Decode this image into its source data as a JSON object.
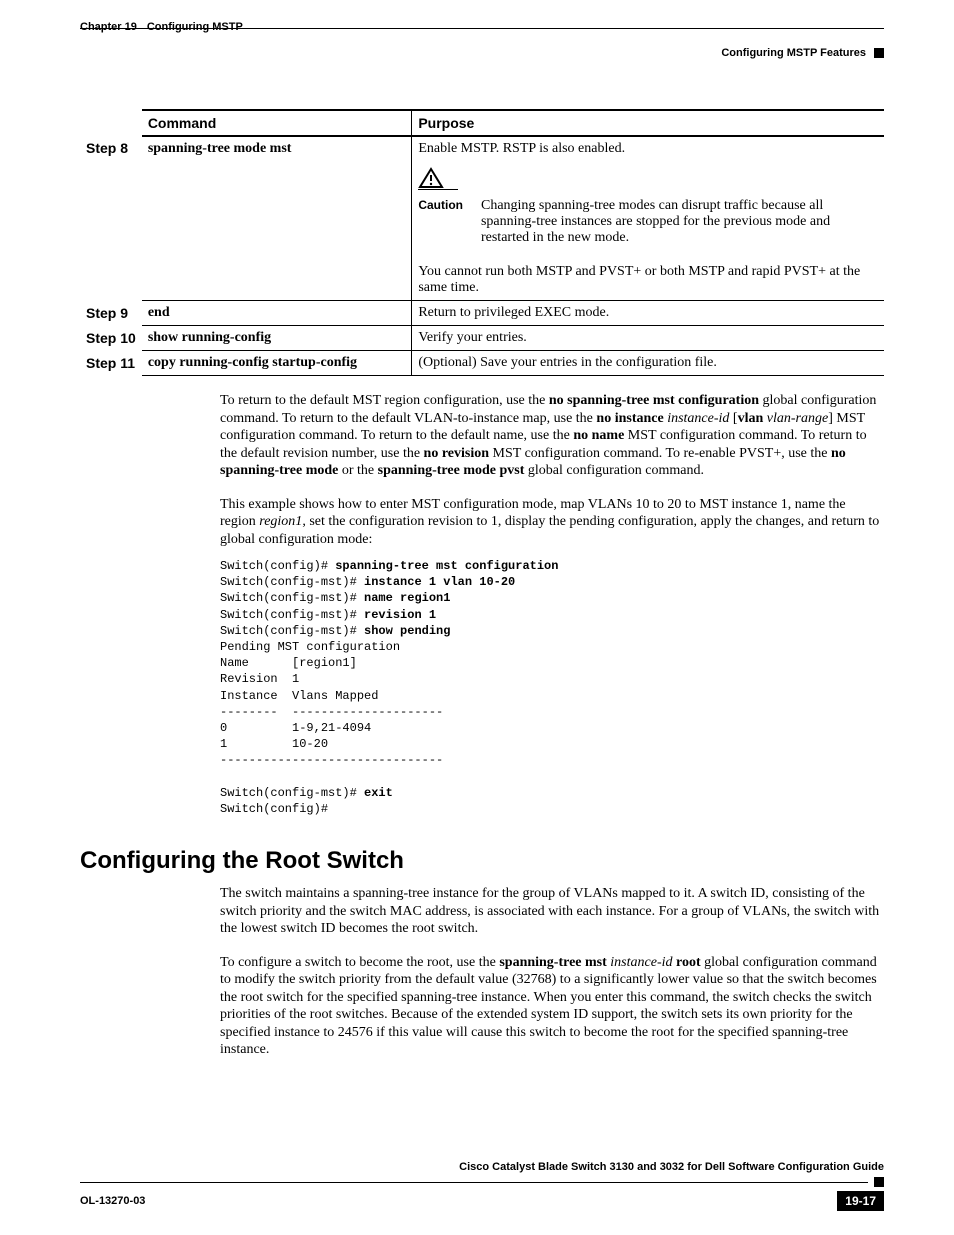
{
  "header": {
    "chapter": "Chapter 19",
    "title": "Configuring MSTP",
    "section_right": "Configuring MSTP Features"
  },
  "table": {
    "headers": {
      "command": "Command",
      "purpose": "Purpose"
    },
    "rows": [
      {
        "step": "Step 8",
        "command": "spanning-tree mode mst",
        "purpose_intro": "Enable MSTP. RSTP is also enabled.",
        "caution_label": "Caution",
        "caution_text": "Changing spanning-tree modes can disrupt traffic because all spanning-tree instances are stopped for the previous mode and restarted in the new mode.",
        "purpose_extra": "You cannot run both MSTP and PVST+ or both MSTP and rapid PVST+ at the same time."
      },
      {
        "step": "Step 9",
        "command": "end",
        "purpose": "Return to privileged EXEC mode."
      },
      {
        "step": "Step 10",
        "command": "show running-config",
        "purpose": "Verify your entries."
      },
      {
        "step": "Step 11",
        "command": "copy running-config startup-config",
        "purpose": "(Optional) Save your entries in the configuration file."
      }
    ]
  },
  "para1": {
    "t1": "To return to the default MST region configuration, use the ",
    "b1": "no spanning-tree mst configuration",
    "t2": " global configuration command. To return to the default VLAN-to-instance map, use the ",
    "b2": "no instance ",
    "i1": "instance-id",
    "t3": " [",
    "b3": "vlan",
    "t3b": " ",
    "i2": "vlan-range",
    "t4": "] MST configuration command. To return to the default name, use the ",
    "b4": "no name",
    "t5": " MST configuration command. To return to the default revision number, use the ",
    "b5": "no revision",
    "t6": " MST configuration command. To re-enable PVST+, use the ",
    "b6": "no spanning-tree mode",
    "t7": " or the ",
    "b7": "spanning-tree mode pvst",
    "t8": " global configuration command."
  },
  "para2": {
    "t1": "This example shows how to enter MST configuration mode, map VLANs 10 to 20 to MST instance 1, name the region ",
    "i1": "region1",
    "t2": ", set the configuration revision to 1, display the pending configuration, apply the changes, and return to global configuration mode:"
  },
  "code": {
    "l1p": "Switch(config)# ",
    "l1b": "spanning-tree mst configuration",
    "l2p": "Switch(config-mst)# ",
    "l2b": "instance 1 vlan 10-20",
    "l3p": "Switch(config-mst)# ",
    "l3b": "name region1",
    "l4p": "Switch(config-mst)# ",
    "l4b": "revision 1",
    "l5p": "Switch(config-mst)# ",
    "l5b": "show pending",
    "l6": "Pending MST configuration",
    "l7": "Name      [region1]",
    "l8": "Revision  1",
    "l9": "Instance  Vlans Mapped",
    "l10": "--------  ---------------------",
    "l11": "0         1-9,21-4094",
    "l12": "1         10-20",
    "l13": "-------------------------------",
    "l14": "",
    "l15p": "Switch(config-mst)# ",
    "l15b": "exit",
    "l16": "Switch(config)#"
  },
  "section2": {
    "heading": "Configuring the Root Switch",
    "p1": "The switch maintains a spanning-tree instance for the group of VLANs mapped to it. A switch ID, consisting of the switch priority and the switch MAC address, is associated with each instance. For a group of VLANs, the switch with the lowest switch ID becomes the root switch.",
    "p2": {
      "t1": "To configure a switch to become the root, use the ",
      "b1": "spanning-tree mst",
      "sp": " ",
      "i1": "instance-id",
      "sp2": " ",
      "b2": "root",
      "t2": " global configuration command to modify the switch priority from the default value (32768) to a significantly lower value so that the switch becomes the root switch for the specified spanning-tree instance. When you enter this command, the switch checks the switch priorities of the root switches. Because of the extended system ID support, the switch sets its own priority for the specified instance to 24576 if this value will cause this switch to become the root for the specified spanning-tree instance."
    }
  },
  "footer": {
    "book": "Cisco Catalyst Blade Switch 3130 and 3032 for Dell Software Configuration Guide",
    "docid": "OL-13270-03",
    "pagenum": "19-17"
  }
}
